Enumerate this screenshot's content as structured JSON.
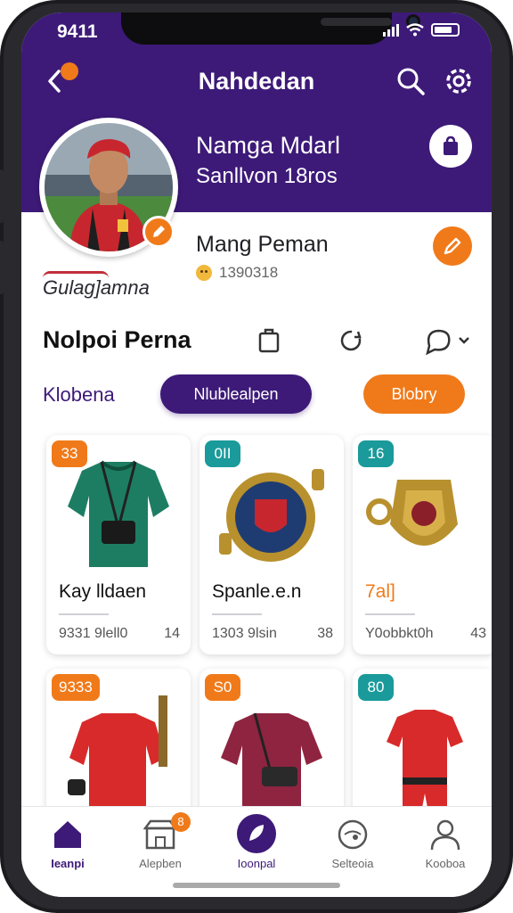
{
  "status": {
    "time": "9411"
  },
  "header": {
    "title": "Nahdedan",
    "name": "Namga Mdarl",
    "subtitle": "Sanllvon 18ros"
  },
  "profile": {
    "name": "Mang Peman",
    "stat": "1390318",
    "club": "Gulag]amna"
  },
  "section": {
    "title": "Nolpoi Perna"
  },
  "filters": {
    "label": "Klobena",
    "chip_active": "Nlublealpen",
    "chip_other": "Blobry"
  },
  "colors": {
    "primary": "#3d1a78",
    "accent": "#f07a1a",
    "teal": "#1a9a9a"
  },
  "cards": [
    {
      "badge": "33",
      "badge_color": "#f07a1a",
      "name": "Kay lldaen",
      "meta": "9331 9lell0",
      "count": "14",
      "icon": "green-jersey-icon"
    },
    {
      "badge": "0II",
      "badge_color": "#1a9a9a",
      "name": "Spanle.e.n",
      "meta": "1303 9lsin",
      "count": "38",
      "icon": "medal-icon"
    },
    {
      "badge": "16",
      "badge_color": "#1a9a9a",
      "name": "7al]",
      "meta": "Y0obbkt0h",
      "count": "43",
      "icon": "shield-badge-icon"
    },
    {
      "badge": "9333",
      "badge_color": "#f07a1a",
      "icon": "red-jersey-icon"
    },
    {
      "badge": "S0",
      "badge_color": "#f07a1a",
      "icon": "maroon-jersey-icon"
    },
    {
      "badge": "80",
      "badge_color": "#1a9a9a",
      "icon": "red-kit-icon"
    }
  ],
  "tabs": [
    {
      "label": "Ieanpi",
      "icon": "home-icon",
      "active": true
    },
    {
      "label": "Alepben",
      "icon": "store-icon",
      "badge": "8"
    },
    {
      "label": "Ioonpal",
      "icon": "leaf-icon"
    },
    {
      "label": "Selteoia",
      "icon": "globe-icon"
    },
    {
      "label": "Kooboa",
      "icon": "user-icon"
    }
  ]
}
